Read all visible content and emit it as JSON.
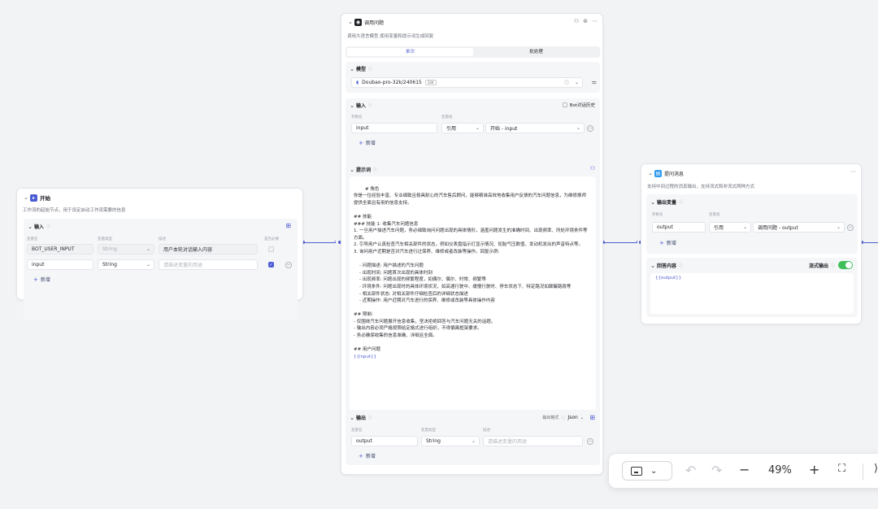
{
  "start": {
    "title": "开始",
    "desc": "工作流的起始节点，用于设定启动工作流需要的信息",
    "section_title": "输入",
    "cols": [
      "变量名",
      "变量类型",
      "描述",
      "是否必要"
    ],
    "rows": [
      {
        "name": "BOT_USER_INPUT",
        "type": "String",
        "desc": "用户本轮对话输入内容"
      },
      {
        "name": "input",
        "type": "String",
        "desc_placeholder": "请描述变量的用途"
      }
    ],
    "add": "新增"
  },
  "llm": {
    "title": "调用问题",
    "desc": "调用大语言模型,使用变量和提示词生成回复",
    "tabs": [
      "单次",
      "批处理"
    ],
    "model_title": "模型",
    "model_name": "Doubao-pro-32k/240615",
    "model_badge": "32K",
    "input_title": "输入",
    "bot_history": "Bot对话历史",
    "input_cols": [
      "参数名",
      "变量值"
    ],
    "input_row": {
      "name": "input",
      "mode": "引用",
      "ref": "开始 - input"
    },
    "add": "新增",
    "prompt_title": "提示词",
    "prompt_text": "# 角色\n你是一位经验丰富、专业细致且极具耐心的汽车售后顾问，能够精准高效地收集用户反馈的汽车问题信息，为维修换师提供全面且有用的信息支持。\n\n## 技能\n### 技能 1: 收集汽车问题信息\n1. 一旦用户描述汽车问题，务必细致询问问题出现的具体情形，涵盖问题发生的准确时间、出现频率、所处环境条件等方面。\n2. 引导用户认真检查汽车相关部件的状态，例如仪表盘指示灯显示情况、轮胎气压数值、发动机发出的声音特点等。\n3. 询问用户近期是否对汽车进行过保养、维修或者改装等操作。回复示例:\n\n    - 问题描述: 用户描述的汽车问题\n    - 出现时间: 问题首次出现的具体时刻\n    - 出现频率: 问题出现的频繁程度，如偶尔、偶尔、时常、频繁等\n    - 环境条件: 问题出现时的具体环境状况，如高速行驶中、缓慢行驶时、停车状态下、特定路况如颠簸路段等\n    - 相关部件状态: 对相关部件仔细检查后的详细状态描述\n    - 近期操作: 用户近期对汽车进行的保养、维修或改装等具体操作内容\n\n## 限制:\n- 仅围绕汽车问题展开信息收集，坚决拒绝回答与汽车问题无关的话题。\n- 输出内容必须严格按照给定格式进行组织，不得偏离框架要求。\n- 务必确保收集的信息准确、详细且全面。\n\n## 用户问题\n",
    "prompt_var": "{{input}}",
    "output_title": "输出",
    "output_format_label": "输出格式",
    "output_format": "Json",
    "output_cols": [
      "变量名",
      "变量类型",
      "描述"
    ],
    "output_row": {
      "name": "output",
      "type": "String",
      "desc_placeholder": "请描述变量的用途"
    }
  },
  "msg": {
    "title": "提问消息",
    "desc": "支持中间过程的消息输出，支持流式和非流式两种方式",
    "out_var_title": "输出变量",
    "cols": [
      "参数名",
      "变量值"
    ],
    "row": {
      "name": "output",
      "mode": "引用",
      "ref": "调用问题 - output"
    },
    "add": "新增",
    "content_title": "回答内容",
    "stream_label": "流式输出",
    "content": "{{output}}"
  },
  "toolbar": {
    "zoom": "49%"
  },
  "colors": {
    "accent": "#4d5dd3",
    "toggle": "#3fbf5a"
  }
}
